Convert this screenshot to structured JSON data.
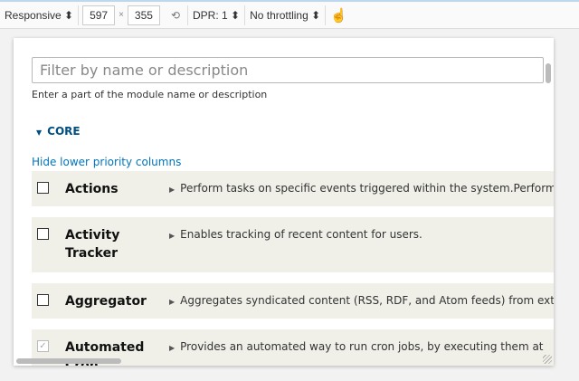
{
  "toolbar": {
    "device": "Responsive ⬍",
    "width": "597",
    "times": "×",
    "height": "355",
    "dpr": "DPR: 1 ⬍",
    "throttling": "No throttling ⬍"
  },
  "page": {
    "filter_placeholder": "Filter by name or description",
    "filter_hint": "Enter a part of the module name or description",
    "section": "CORE",
    "section_arrow": "▼",
    "hide_link": "Hide lower priority columns"
  },
  "modules": [
    {
      "name": "Actions",
      "desc": "Perform tasks on specific events triggered within the system.Perform",
      "checked": false
    },
    {
      "name": "Activity Tracker",
      "desc": "Enables tracking of recent content for users.",
      "checked": false
    },
    {
      "name": "Aggregator",
      "desc": "Aggregates syndicated content (RSS, RDF, and Atom feeds) from external",
      "checked": false
    },
    {
      "name": "Automated Cron",
      "desc": "Provides an automated way to run cron jobs, by executing them at",
      "checked": true
    }
  ]
}
